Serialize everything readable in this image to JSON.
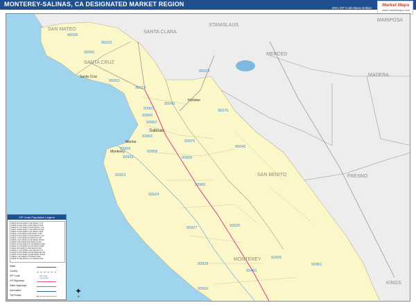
{
  "header": {
    "title": "MONTEREY-SALINAS, CA DESIGNATED MARKET REGION",
    "edition": "2021 ZIP Code Basic Edition",
    "logo_main": "Market Maps",
    "logo_sub": "www.marketmaps.com"
  },
  "map": {
    "ocean_color": "#9fd4ee",
    "region_color": "#fbf7c8",
    "outside_color": "#ededed",
    "river_color": "#7fb8de",
    "county_labels": [
      "SAN MATEO",
      "SANTA CLARA",
      "STANISLAUS",
      "MARIPOSA",
      "MERCED",
      "MADERA",
      "SANTA CRUZ",
      "SAN BENITO",
      "FRESNO",
      "MONTEREY",
      "KINGS"
    ],
    "city_labels": [
      "Santa Cruz",
      "Salinas",
      "Marina",
      "Monterey",
      "Hollister"
    ],
    "zip_labels": [
      "95006",
      "95003",
      "95005",
      "95033",
      "95023",
      "95019",
      "95045",
      "95075",
      "93907",
      "93962",
      "93906",
      "93901",
      "93905",
      "95043",
      "93975",
      "93925",
      "93933",
      "93908",
      "93923",
      "93960",
      "93924",
      "93927",
      "93926",
      "93928",
      "93426",
      "93450",
      "93451",
      "93920"
    ]
  },
  "legend": {
    "title": "ZIP Code Population Legend",
    "zip_rows": [
      "93901 38,220 93920 1,040 95004 4,170",
      "93905 61,020 93921 3,650 95012 8,290",
      "93906 62,170 93923 16,540 95019 7,210",
      "93907 24,880 93924 7,340 95023 53,600",
      "93908 14,060 93925 3,410 95043 2,880",
      "93920 1,130 93926 6,960 95045 4,330",
      "93923 16,540 93927 20,540 95075 1,210",
      "93924 7,340 93928 340 95076 81,780",
      "93925 3,410 93930 14,130 95003 29,860",
      "93926 6,960 93932 820 95005 10,010",
      "93927 20,540 93933 21,760 95006 15,890",
      "93930 14,130 93940 31,870 95010 9,880",
      "93932 820 93950 15,340 95018 8,620",
      "93933 21,760 93953 4,420 95033 8,770",
      "93940 31,870 93955 35,780 95060 58,140",
      "93950 15,340 93960 13,080 95062 38,440",
      "93953 4,420 93962 370 95064 9,890",
      "93955 35,780 95004 4,170 95065 8,360"
    ],
    "keys": [
      "State",
      "County",
      "ZIP Code",
      "US Highways",
      "State Highways",
      "Interstates",
      "Toll Roads"
    ],
    "key_samples": [
      "ZIP Code",
      "Population"
    ]
  },
  "compass_label": "N"
}
